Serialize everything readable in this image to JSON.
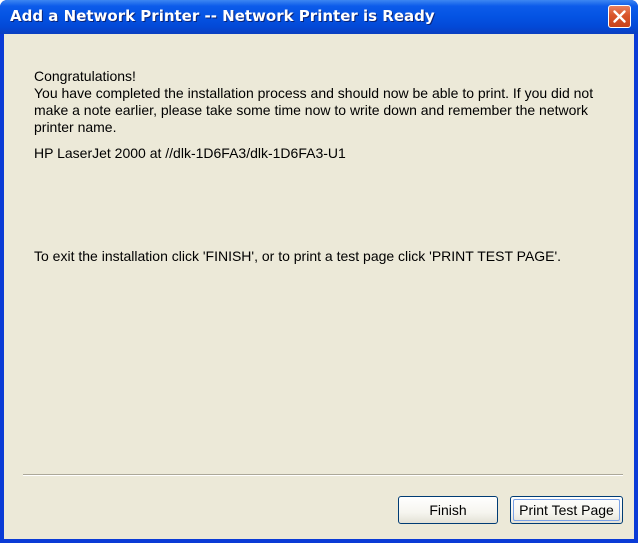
{
  "window": {
    "title": "Add a Network Printer -- Network Printer is Ready"
  },
  "content": {
    "heading": "Congratulations!",
    "message": "You have completed the installation process and should now be able to print. If you did not make a note earlier, please take some time now to write down and remember the network printer name.",
    "printer_name": "HP LaserJet 2000 at //dlk-1D6FA3/dlk-1D6FA3-U1",
    "instructions": "To exit the installation click 'FINISH', or to print a test page click 'PRINT TEST PAGE'."
  },
  "buttons": {
    "finish_label": "Finish",
    "print_test_label": "Print Test Page"
  },
  "icons": {
    "close": "close-icon"
  },
  "colors": {
    "titlebar": "#0453e3",
    "dialog_background": "#ece9d8",
    "close_button": "#d9552b"
  }
}
